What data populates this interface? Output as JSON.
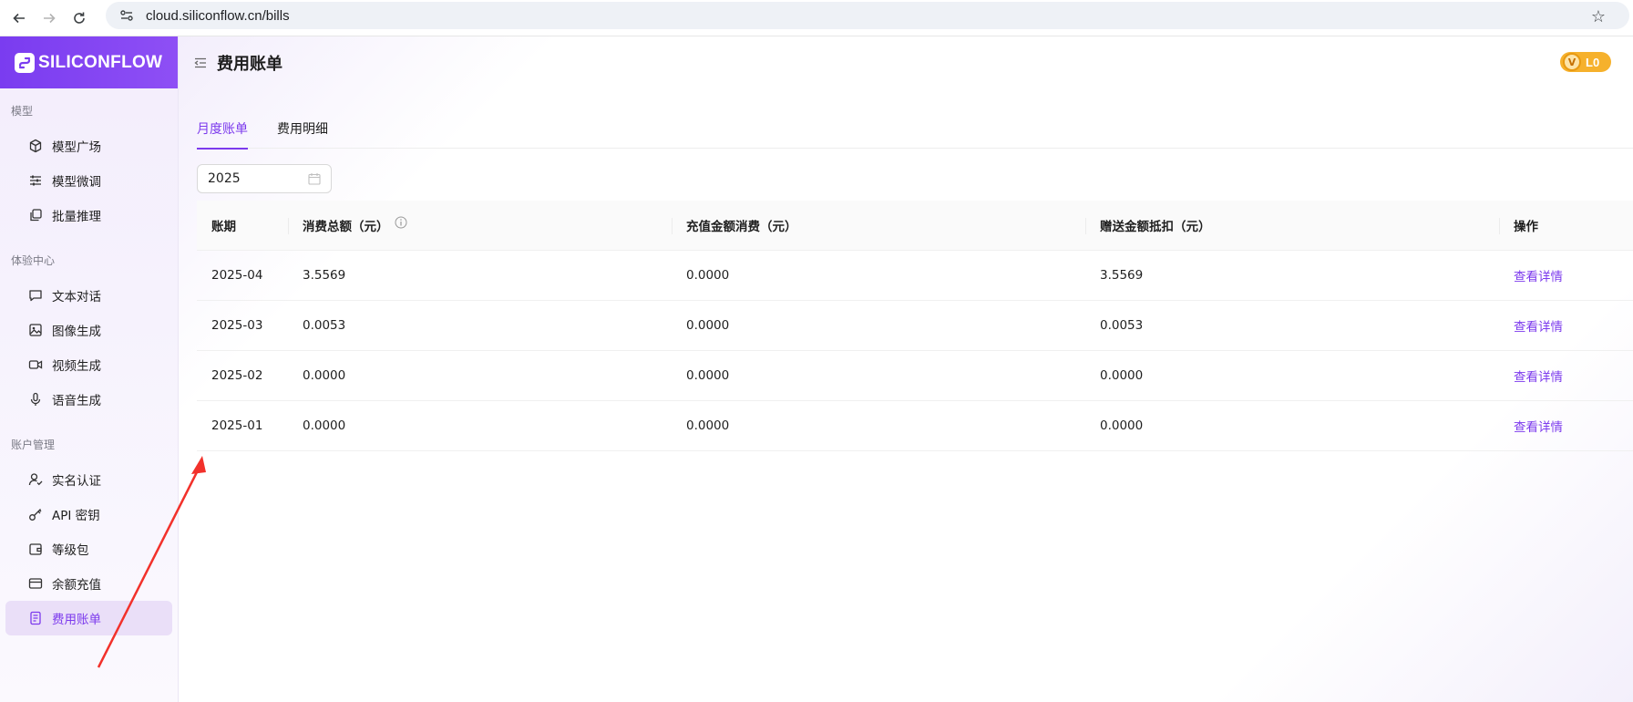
{
  "browser": {
    "url": "cloud.siliconflow.cn/bills"
  },
  "sidebar": {
    "logo": "SILICONFLOW",
    "sections": [
      {
        "title": "模型",
        "items": [
          {
            "label": "模型广场",
            "icon": "cube-icon"
          },
          {
            "label": "模型微调",
            "icon": "sliders-icon"
          },
          {
            "label": "批量推理",
            "icon": "batch-icon"
          }
        ]
      },
      {
        "title": "体验中心",
        "items": [
          {
            "label": "文本对话",
            "icon": "chat-icon"
          },
          {
            "label": "图像生成",
            "icon": "image-icon"
          },
          {
            "label": "视频生成",
            "icon": "video-icon"
          },
          {
            "label": "语音生成",
            "icon": "microphone-icon"
          }
        ]
      },
      {
        "title": "账户管理",
        "items": [
          {
            "label": "实名认证",
            "icon": "user-check-icon"
          },
          {
            "label": "API 密钥",
            "icon": "key-icon"
          },
          {
            "label": "等级包",
            "icon": "wallet-icon"
          },
          {
            "label": "余额充值",
            "icon": "card-icon"
          },
          {
            "label": "费用账单",
            "icon": "document-icon",
            "active": true
          }
        ]
      }
    ]
  },
  "header": {
    "title": "费用账单",
    "level": "L0",
    "level_mark": "V"
  },
  "tabs": [
    {
      "label": "月度账单",
      "active": true
    },
    {
      "label": "费用明细",
      "active": false
    }
  ],
  "filter": {
    "year": "2025"
  },
  "table": {
    "columns": [
      "账期",
      "消费总额（元）",
      "充值金额消费（元）",
      "赠送金额抵扣（元）",
      "操作"
    ],
    "rows": [
      {
        "period": "2025-04",
        "total": "3.5569",
        "recharge": "0.0000",
        "gift": "3.5569",
        "action": "查看详情"
      },
      {
        "period": "2025-03",
        "total": "0.0053",
        "recharge": "0.0000",
        "gift": "0.0053",
        "action": "查看详情"
      },
      {
        "period": "2025-02",
        "total": "0.0000",
        "recharge": "0.0000",
        "gift": "0.0000",
        "action": "查看详情"
      },
      {
        "period": "2025-01",
        "total": "0.0000",
        "recharge": "0.0000",
        "gift": "0.0000",
        "action": "查看详情"
      }
    ]
  },
  "colors": {
    "accent": "#7c3aed",
    "annotation_arrow": "#f2312b",
    "badge": "#f6b12c"
  }
}
